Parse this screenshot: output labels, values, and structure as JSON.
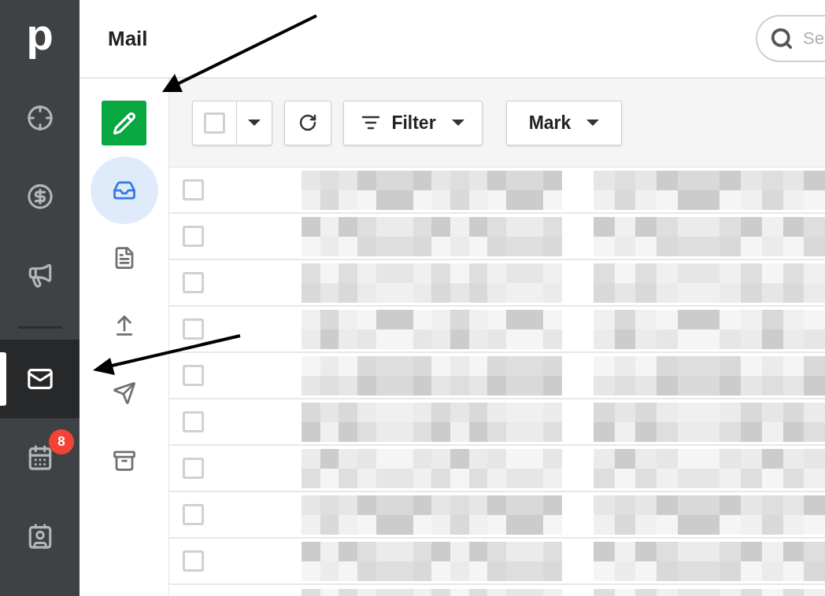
{
  "app_rail": {
    "logo": "p",
    "items": [
      {
        "kind": "target",
        "selected": false
      },
      {
        "kind": "deals",
        "selected": false
      },
      {
        "kind": "campaigns",
        "selected": false
      },
      {
        "kind": "mail",
        "selected": true,
        "divider_above": true
      },
      {
        "kind": "calendar",
        "selected": false,
        "badge": "8"
      },
      {
        "kind": "contacts",
        "selected": false
      }
    ]
  },
  "header": {
    "title": "Mail",
    "search": {
      "placeholder": "Se"
    }
  },
  "folders": [
    {
      "kind": "inbox",
      "selected": true
    },
    {
      "kind": "drafts",
      "selected": false
    },
    {
      "kind": "outbox",
      "selected": false
    },
    {
      "kind": "sent",
      "selected": false
    },
    {
      "kind": "archive",
      "selected": false
    }
  ],
  "toolbar": {
    "select_all": {
      "checked": false
    },
    "filter": "Filter",
    "mark": "Mark"
  },
  "rows": [
    {
      "checked": false
    },
    {
      "checked": false
    },
    {
      "checked": false
    },
    {
      "checked": false
    },
    {
      "checked": false
    },
    {
      "checked": false
    },
    {
      "checked": false
    },
    {
      "checked": false
    },
    {
      "checked": false
    }
  ]
}
